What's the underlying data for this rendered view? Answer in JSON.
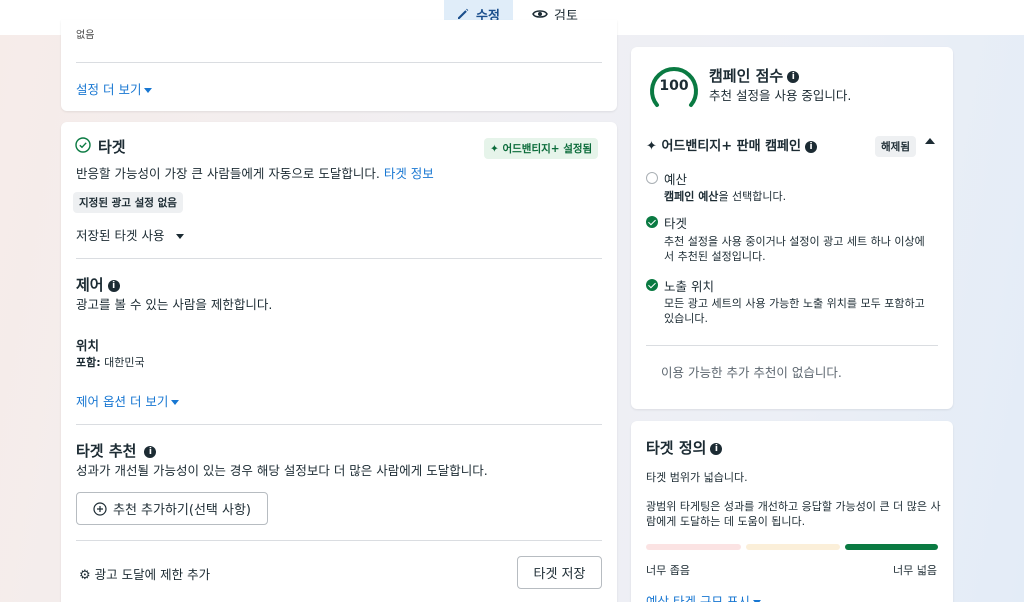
{
  "topbar": {
    "edit_label": "수정",
    "review_label": "검토"
  },
  "top_card": {
    "cut_text": "없음",
    "more_settings": "설정 더 보기"
  },
  "target": {
    "title": "타겟",
    "badge": "어드밴티지+ 설정됨",
    "description": "반응할 가능성이 가장 큰 사람들에게 자동으로 도달합니다.",
    "description_link": "타겟 정보",
    "no_settings_chip": "지정된 광고 설정 없음",
    "saved_target_dropdown": "저장된 타겟 사용",
    "control": {
      "title": "제어",
      "description": "광고를 볼 수 있는 사람을 제한합니다.",
      "location_label": "위치",
      "include_label": "포함:",
      "include_value": "대한민국",
      "more_options": "제어 옵션 더 보기"
    },
    "suggestion": {
      "title": "타겟 추천",
      "description": "성과가 개선될 가능성이 있는 경우 해당 설정보다 더 많은 사람에게 도달합니다.",
      "add_button": "추천 추가하기(선택 사항)"
    },
    "footer": {
      "add_limit": "광고 도달에 제한 추가",
      "save_button": "타겟 저장"
    }
  },
  "score": {
    "value": "100",
    "title": "캠페인 점수",
    "subtitle": "추천 설정을 사용 중입니다.",
    "campaign_title": "어드밴티지+ 판매 캠페인",
    "status_pill": "해제됨",
    "items": [
      {
        "title": "예산",
        "desc_bold": "캠페인 예산",
        "desc_rest": "을 선택합니다.",
        "done": false
      },
      {
        "title": "타겟",
        "desc_line1": "추천 설정을 사용 중이거나 설정이 광고 세트 하나 이상에",
        "desc_line2": "서 추천된 설정입니다.",
        "done": true
      },
      {
        "title": "노출 위치",
        "desc_line1": "모든 광고 세트의 사용 가능한 노출 위치를 모두 포함하고",
        "desc_line2": "있습니다.",
        "done": true
      }
    ],
    "no_more": "이용 가능한 추가 추천이 없습니다."
  },
  "definition": {
    "title": "타겟 정의",
    "state": "타겟 범위가 넓습니다.",
    "desc_line1": "광범위 타게팅은 성과를 개선하고 응답할 가능성이 큰 더 많은 사",
    "desc_line2": "람에게 도달하는 데 도움이 됩니다.",
    "narrow_label": "너무 좁음",
    "wide_label": "너무 넓음",
    "estimate_link": "예상 타겟 규모 표시",
    "colors": {
      "narrow": "#fbe3e3",
      "mid": "#fbefd9",
      "wide": "#0a7a42"
    }
  }
}
